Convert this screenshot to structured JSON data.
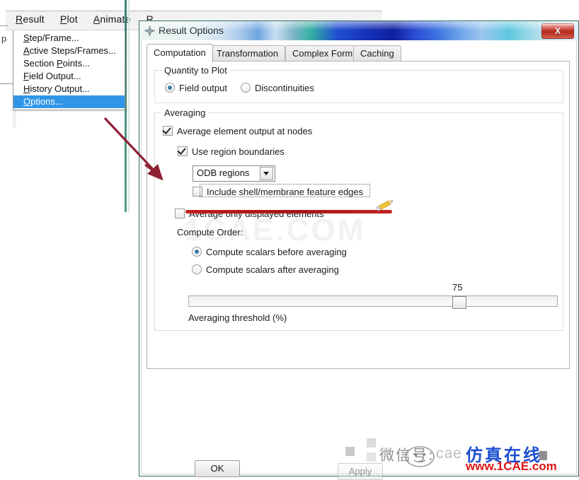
{
  "host_app": {
    "menubar": {
      "items": [
        {
          "label": "Result",
          "mnemonic": "R"
        },
        {
          "label": "Plot",
          "mnemonic": "P"
        },
        {
          "label": "Animate",
          "mnemonic": "A"
        },
        {
          "label": "R",
          "mnemonic": "R"
        }
      ]
    },
    "left_edge_letter": "p"
  },
  "result_menu": {
    "name": "Result",
    "items": [
      {
        "label": "Step/Frame...",
        "selected": false
      },
      {
        "label": "Active Steps/Frames...",
        "selected": false
      },
      {
        "label": "Section Points...",
        "selected": false
      },
      {
        "label": "Field Output...",
        "selected": false
      },
      {
        "label": "History Output...",
        "selected": false
      },
      {
        "label": "Options...",
        "selected": true
      }
    ]
  },
  "dialog": {
    "title": "Result Options",
    "close_label": "X",
    "tabs": [
      {
        "label": "Computation",
        "active": true
      },
      {
        "label": "Transformation",
        "active": false
      },
      {
        "label": "Complex Form",
        "active": false
      },
      {
        "label": "Caching",
        "active": false
      }
    ],
    "quantity_group": {
      "legend": "Quantity to Plot",
      "options": [
        {
          "label": "Field output",
          "checked": true
        },
        {
          "label": "Discontinuities",
          "checked": false
        }
      ]
    },
    "averaging_group": {
      "legend": "Averaging",
      "average_element_output": {
        "label": "Average element output at nodes",
        "checked": true
      },
      "use_region_boundaries": {
        "label": "Use region boundaries",
        "checked": true
      },
      "region_combo": {
        "value": "ODB regions",
        "options": [
          "ODB regions"
        ]
      },
      "include_feature_edges": {
        "label": "Include shell/membrane feature edges",
        "checked": false
      },
      "average_only_displayed": {
        "label": "Average only displayed elements",
        "checked": false
      },
      "compute_order_label": "Compute Order:",
      "compute_order_options": [
        {
          "label": "Compute scalars before averaging",
          "checked": true
        },
        {
          "label": "Compute scalars after averaging",
          "checked": false
        }
      ],
      "threshold": {
        "label": "Averaging threshold (%)",
        "value": "75",
        "min": 0,
        "max": 100
      }
    },
    "buttons": [
      {
        "label": "OK"
      },
      {
        "label": "Apply"
      }
    ]
  },
  "annotations": {
    "arrow_color": "#8f2033",
    "underline_color": "#b81b1b",
    "pencil_icon": "pencil-icon"
  },
  "watermarks": {
    "center_text": "1CAE.COM",
    "bottom_wechat_cn": "微信号:",
    "bottom_gray": "cae",
    "bottom_blue_cn": "仿真在线",
    "bottom_url": "www.1CAE.com"
  }
}
